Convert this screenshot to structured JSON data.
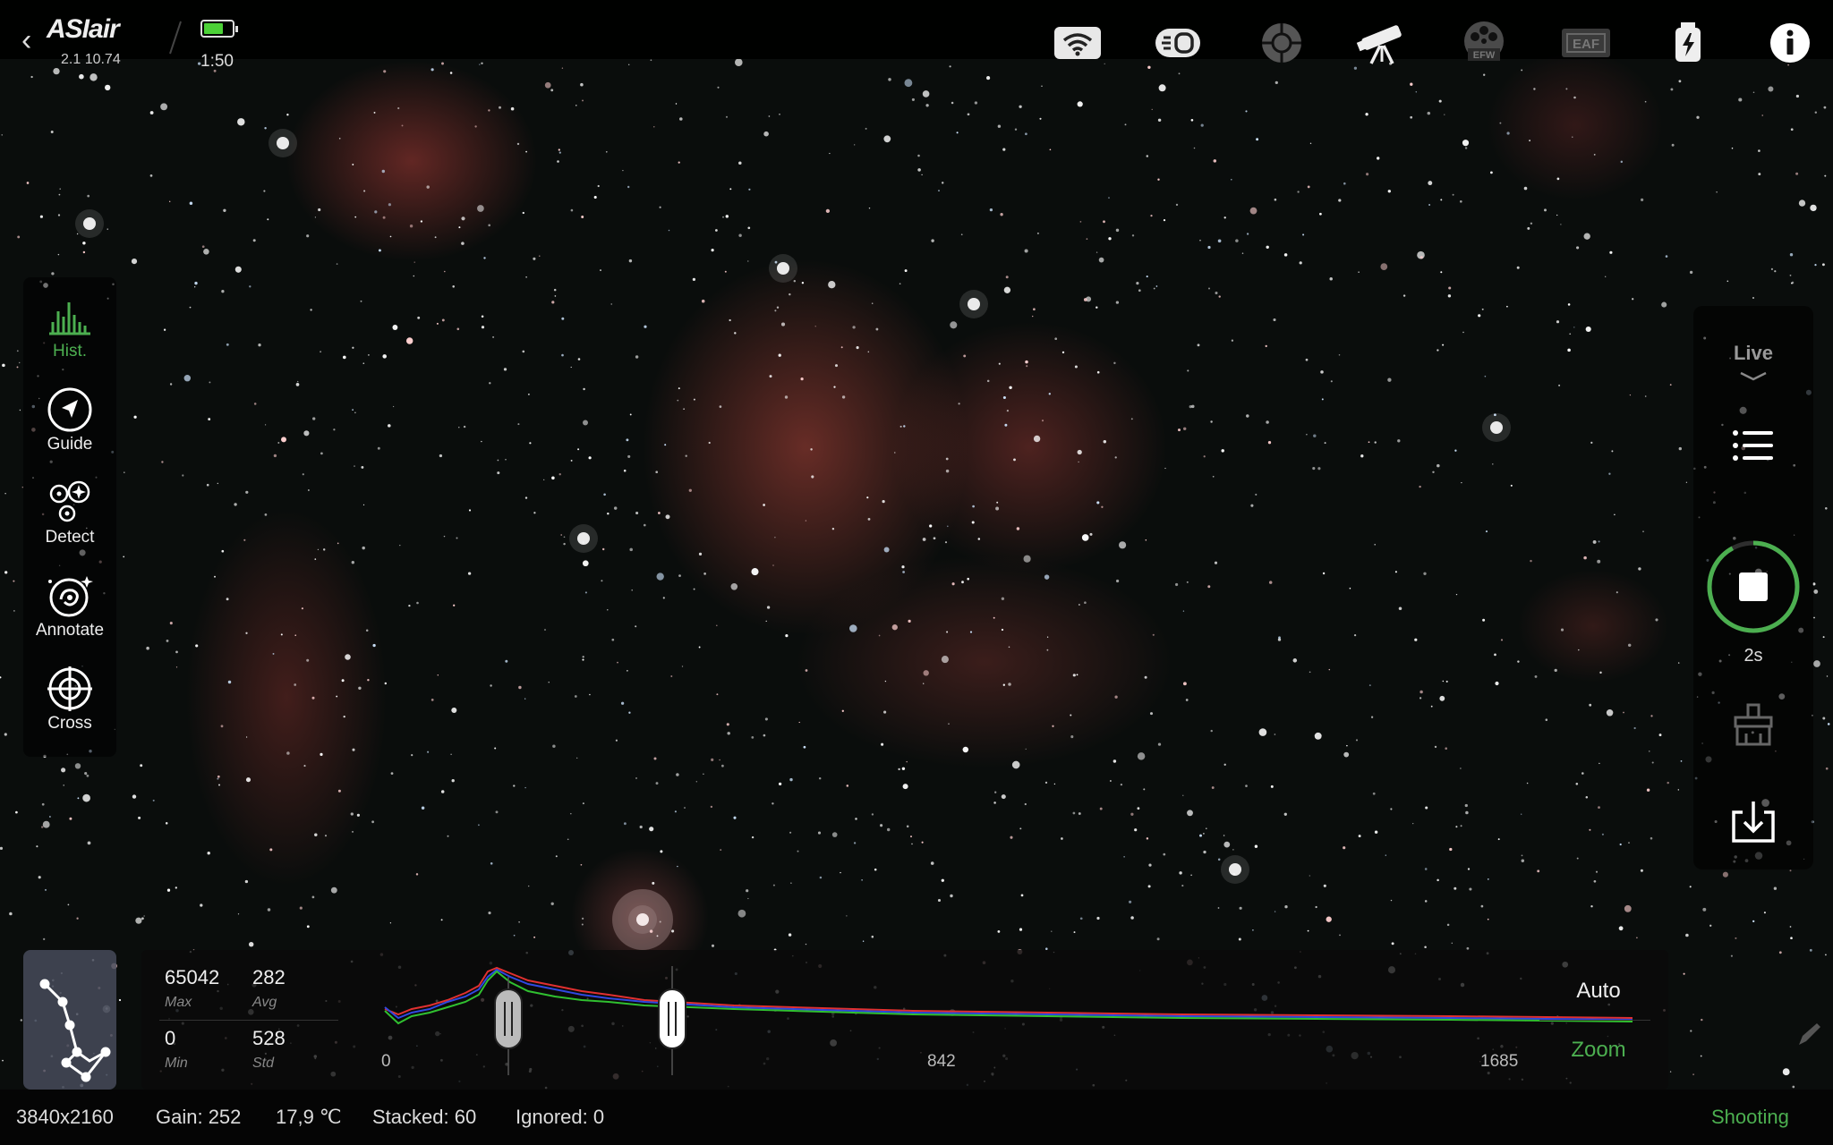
{
  "app": {
    "logo": "ASIair",
    "version": "2.1 10.74",
    "battery_level": 0.7,
    "time": "1:50"
  },
  "top_icons": [
    "wifi-icon",
    "camera-icon",
    "guide-scope-icon",
    "telescope-icon",
    "efw-icon",
    "eaf-icon",
    "power-icon",
    "info-icon"
  ],
  "top_icon_text": {
    "efw": "EFW",
    "eaf": "EAF"
  },
  "tools": [
    {
      "label": "Hist.",
      "icon": "histogram-icon",
      "active": true
    },
    {
      "label": "Guide",
      "icon": "guide-icon",
      "active": false
    },
    {
      "label": "Detect",
      "icon": "detect-icon",
      "active": false
    },
    {
      "label": "Annotate",
      "icon": "galaxy-icon",
      "active": false
    },
    {
      "label": "Cross",
      "icon": "crosshair-icon",
      "active": false
    }
  ],
  "right_panel": {
    "mode": "Live",
    "exposure": "2s",
    "accent": "#4caf50"
  },
  "histogram": {
    "max": "65042",
    "max_label": "Max",
    "avg": "282",
    "avg_label": "Avg",
    "min": "0",
    "min_label": "Min",
    "std": "528",
    "std_label": "Std",
    "axis_start": "0",
    "axis_mid": "842",
    "axis_end": "1685",
    "auto_label": "Auto",
    "zoom_label": "Zoom"
  },
  "status": {
    "resolution": "3840x2160",
    "gain": "Gain: 252",
    "temperature": "17,9 ℃",
    "stacked": "Stacked: 60",
    "ignored": "Ignored: 0",
    "state": "Shooting",
    "state_color": "#4caf50"
  }
}
